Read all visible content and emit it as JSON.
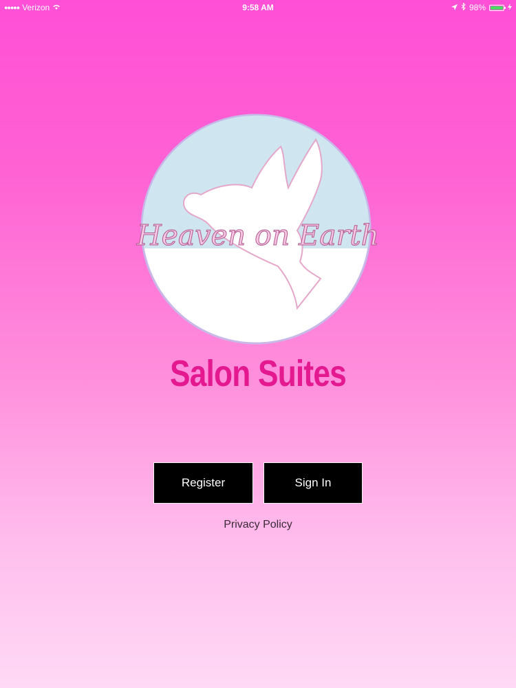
{
  "status_bar": {
    "signal_dots": "●●●●●",
    "carrier": "Verizon",
    "time": "9:58 AM",
    "battery_percent": "98%",
    "battery_level": 0.98,
    "icons": [
      "signal-icon",
      "wifi-icon",
      "location-icon",
      "bluetooth-icon",
      "battery-icon",
      "charging-icon"
    ]
  },
  "logo": {
    "script_text": "Heaven on Earth",
    "circle_top_color": "#cfe6f1",
    "circle_bottom_color": "#ffffff"
  },
  "brand": {
    "title": "Salon Suites",
    "color": "#e4198f"
  },
  "actions": {
    "register_label": "Register",
    "signin_label": "Sign In",
    "privacy_label": "Privacy Policy"
  },
  "colors": {
    "background_top": "#ff4fd6",
    "background_bottom": "#ffd9f5",
    "button_bg": "#000000",
    "button_text": "#ffffff"
  }
}
